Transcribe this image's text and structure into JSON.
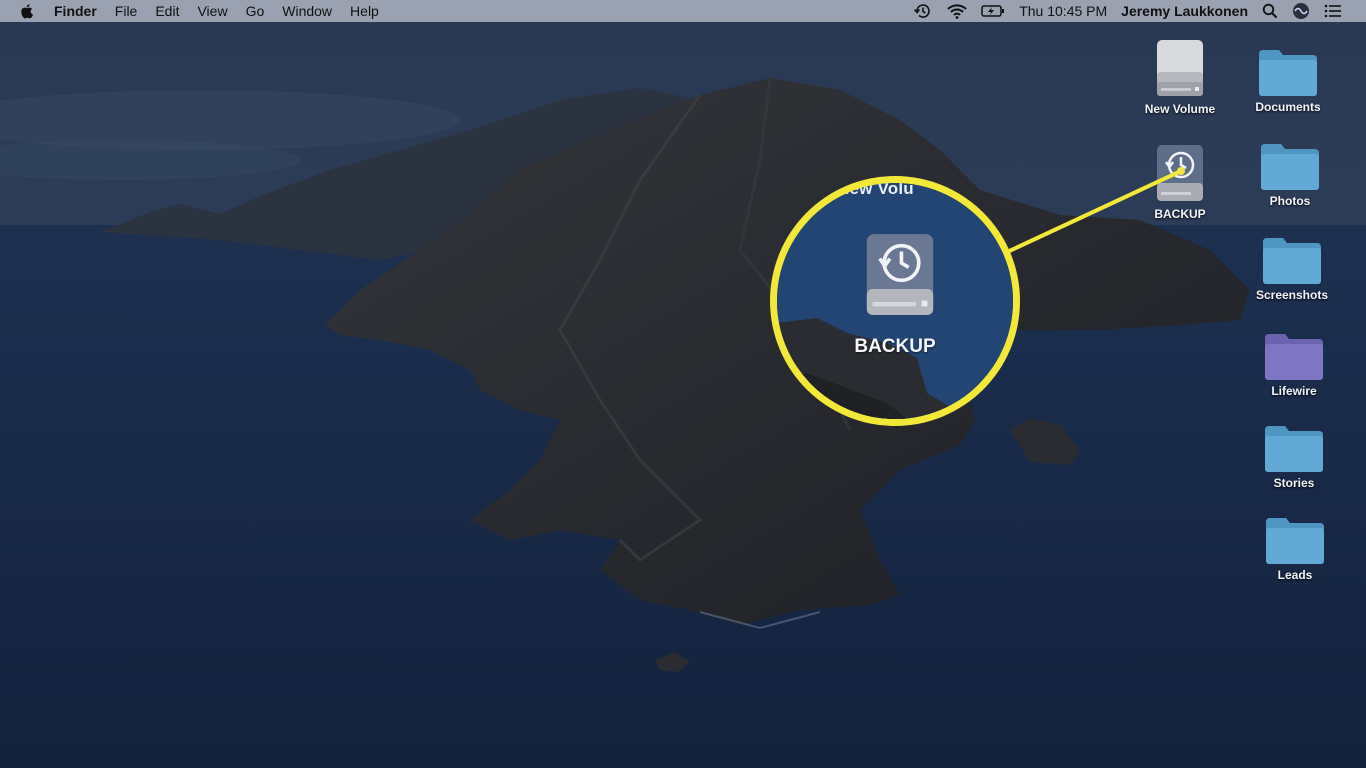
{
  "menubar": {
    "app_name": "Finder",
    "menus": [
      "File",
      "Edit",
      "View",
      "Go",
      "Window",
      "Help"
    ],
    "clock": "Thu 10:45 PM",
    "user": "Jeremy Laukkonen",
    "status_icons": [
      "time-machine-icon",
      "wifi-icon",
      "battery-charging-icon",
      "search-icon",
      "siri-icon",
      "notification-center-icon"
    ]
  },
  "desktop": {
    "drives": [
      {
        "label": "New Volume",
        "icon": "drive-icon"
      },
      {
        "label": "BACKUP",
        "icon": "time-machine-drive-icon"
      }
    ],
    "folders": [
      {
        "label": "Documents",
        "color": "#4f95c2"
      },
      {
        "label": "Photos",
        "color": "#4f95c2"
      },
      {
        "label": "Screenshots",
        "color": "#4f95c2"
      },
      {
        "label": "Lifewire",
        "color": "#6c63b0"
      },
      {
        "label": "Stories",
        "color": "#4f95c2"
      },
      {
        "label": "Leads",
        "color": "#4f95c2"
      }
    ]
  },
  "callout": {
    "partial_text": "New Volu",
    "label": "BACKUP",
    "ring_color": "#f2e83a"
  }
}
